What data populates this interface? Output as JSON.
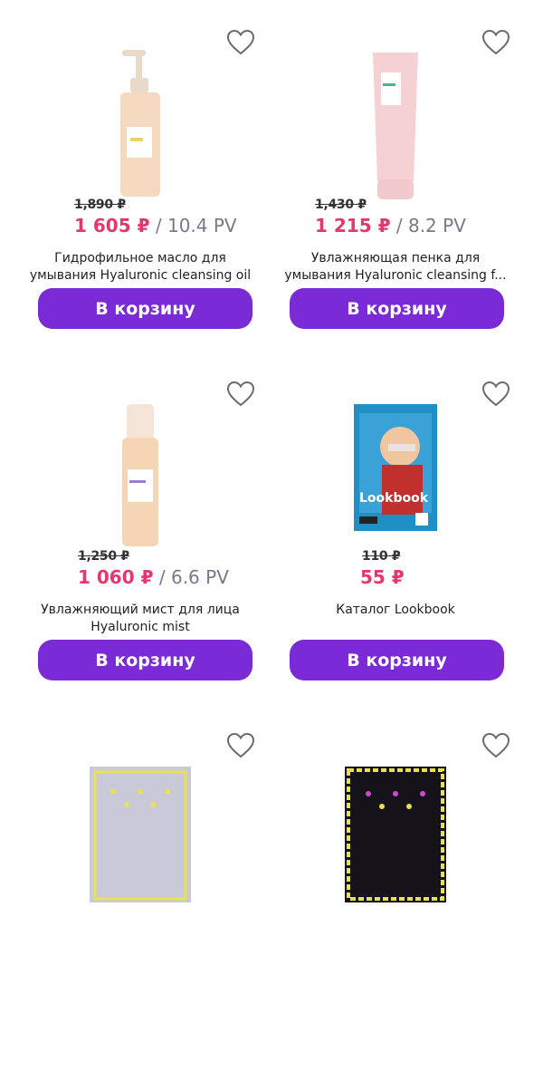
{
  "colors": {
    "accent": "#7b2bd6",
    "price": "#e2386f",
    "pv": "#757a8a"
  },
  "products": [
    {
      "old_price": "1,890 ₽",
      "price": "1 605 ₽",
      "sep": " / ",
      "pv": "10.4 PV",
      "title_line1": "Гидрофильное масло для",
      "title_line2": "умывания Hyaluronic cleansing oil",
      "button": "В корзину",
      "favorite_icon": "heart-outline-icon",
      "image": "cleansing-oil-pump-bottle"
    },
    {
      "old_price": "1,430 ₽",
      "price": "1 215 ₽",
      "sep": " / ",
      "pv": "8.2 PV",
      "title_line1": "Увлажняющая пенка для",
      "title_line2": "умывания Hyaluronic cleansing f...",
      "button": "В корзину",
      "favorite_icon": "heart-outline-icon",
      "image": "cleansing-foam-tube"
    },
    {
      "old_price": "1,250 ₽",
      "price": "1 060 ₽",
      "sep": " / ",
      "pv": "6.6 PV",
      "title_line1": "Увлажняющий мист для лица",
      "title_line2": "Hyaluronic mist",
      "button": "В корзину",
      "favorite_icon": "heart-outline-icon",
      "image": "face-mist-bottle"
    },
    {
      "old_price": "110 ₽",
      "price": "55 ₽",
      "title_line1": "Каталог Lookbook",
      "button": "В корзину",
      "favorite_icon": "heart-outline-icon",
      "image": "lookbook-catalog",
      "image_text": "Lookbook"
    },
    {
      "favorite_icon": "heart-outline-icon",
      "image": "scarf-lavender-yellow"
    },
    {
      "favorite_icon": "heart-outline-icon",
      "image": "scarf-black-yellow"
    }
  ]
}
